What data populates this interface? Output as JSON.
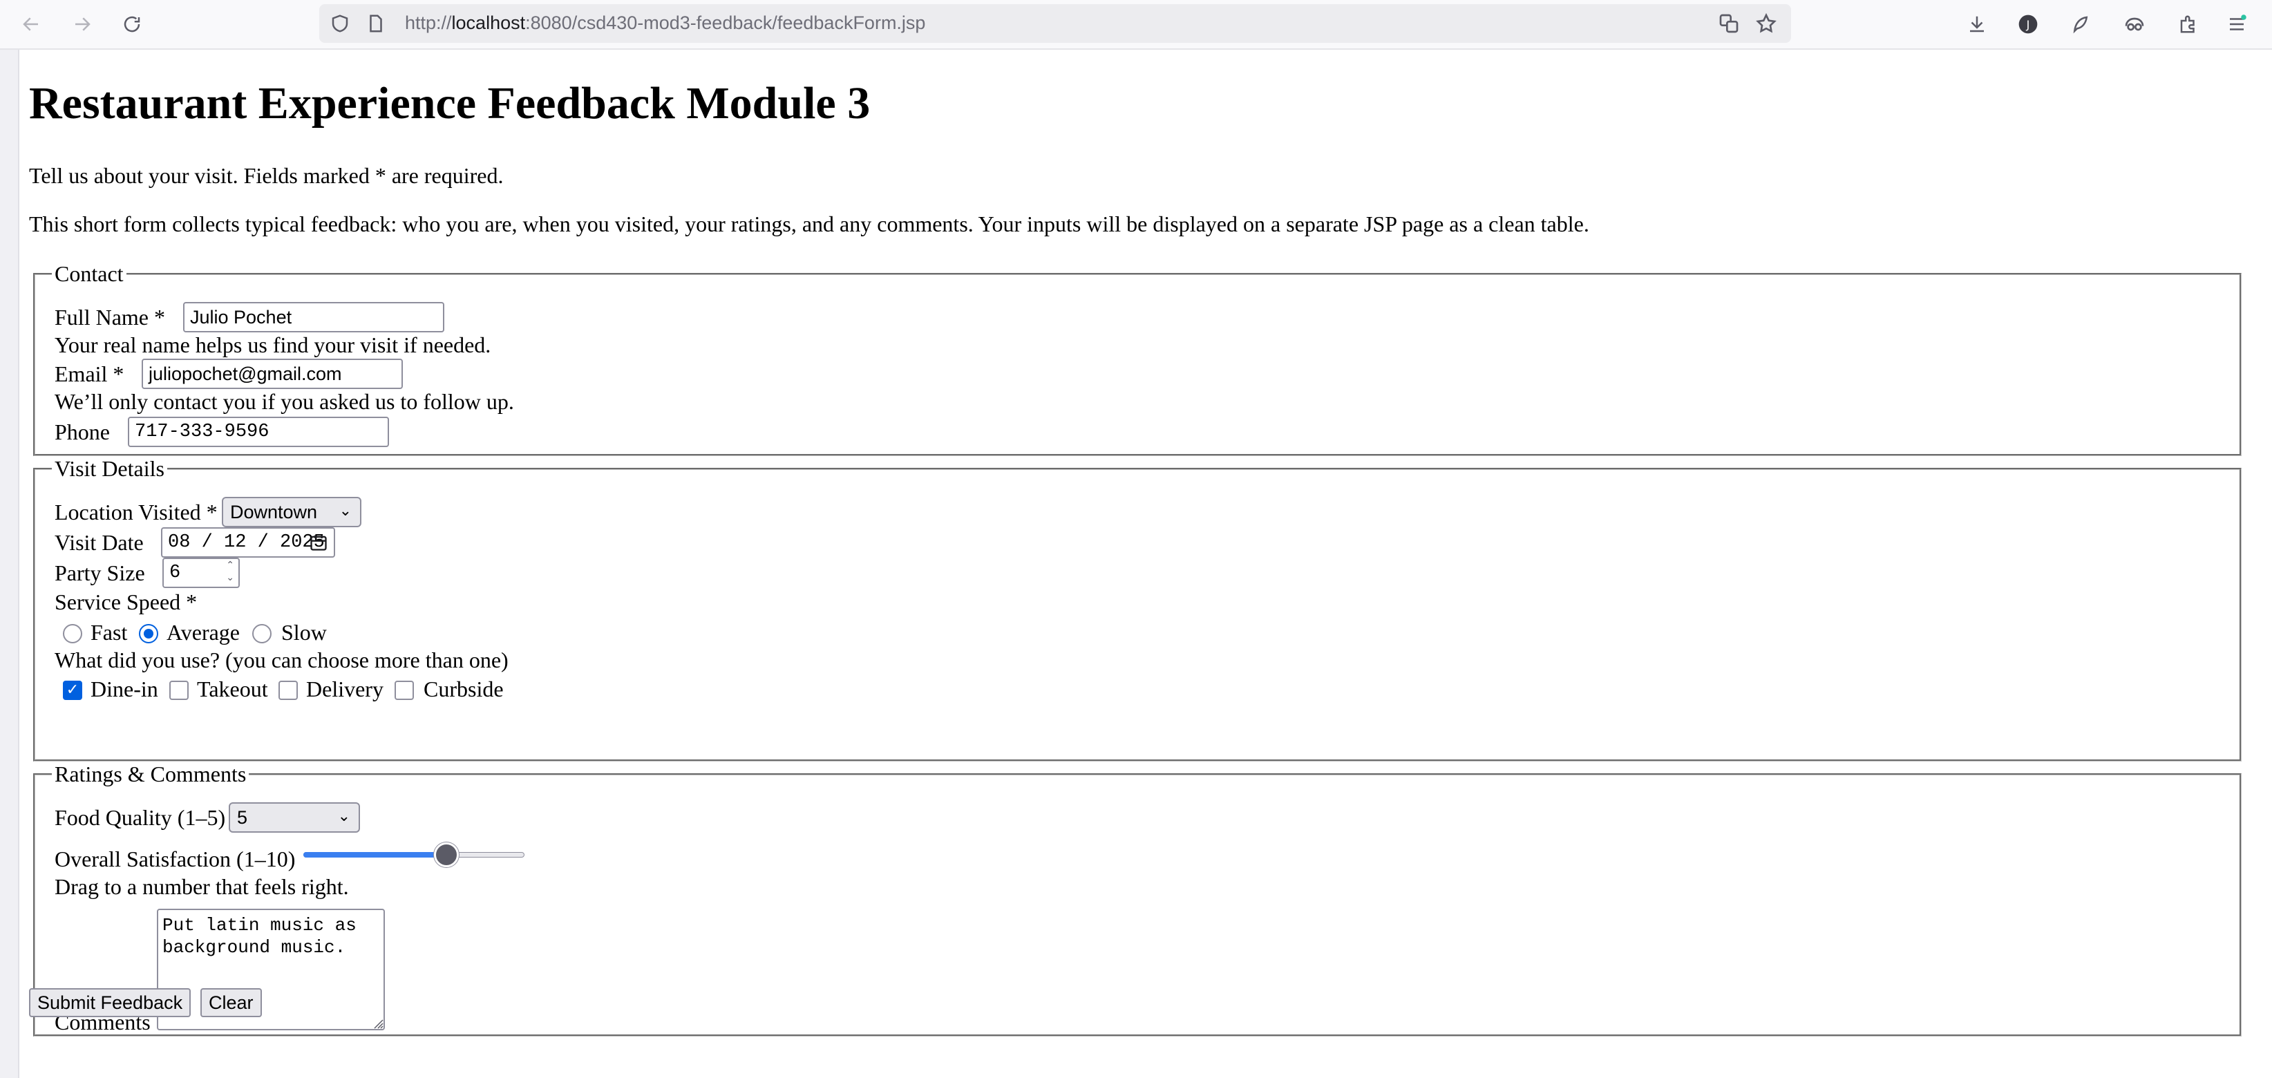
{
  "browser": {
    "url_prefix": "http://",
    "url_host": "localhost",
    "url_rest": ":8080/csd430-mod3-feedback/feedbackForm.jsp",
    "back_icon": "arrow-left-icon",
    "forward_icon": "arrow-right-icon",
    "reload_icon": "reload-icon"
  },
  "page": {
    "title": "Restaurant Experience Feedback Module 3",
    "intro1": "Tell us about your visit. Fields marked * are required.",
    "intro2": "This short form collects typical feedback: who you are, when you visited, your ratings, and any comments. Your inputs will be displayed on a separate JSP page as a clean table."
  },
  "contact": {
    "legend": "Contact",
    "name_label": "Full Name *",
    "name_value": "Julio Pochet",
    "name_help": "Your real name helps us find your visit if needed.",
    "email_label": "Email *",
    "email_value": "juliopochet@gmail.com",
    "email_help": "We’ll only contact you if you asked us to follow up.",
    "phone_label": "Phone",
    "phone_value": "717-333-9596"
  },
  "visit": {
    "legend": "Visit Details",
    "location_label": "Location Visited *",
    "location_value": "Downtown",
    "date_label": "Visit Date",
    "date_value": "08 / 12 / 2025",
    "party_label": "Party Size",
    "party_value": "6",
    "speed_label": "Service Speed *",
    "speed_options": [
      {
        "label": "Fast",
        "checked": false
      },
      {
        "label": "Average",
        "checked": true
      },
      {
        "label": "Slow",
        "checked": false
      }
    ],
    "use_label": "What did you use? (you can choose more than one)",
    "use_options": [
      {
        "label": "Dine-in",
        "checked": true
      },
      {
        "label": "Takeout",
        "checked": false
      },
      {
        "label": "Delivery",
        "checked": false
      },
      {
        "label": "Curbside",
        "checked": false
      }
    ]
  },
  "ratings": {
    "legend": "Ratings & Comments",
    "food_label": "Food Quality (1–5)",
    "food_value": "5",
    "satisfaction_label": "Overall Satisfaction (1–10)",
    "satisfaction_value": 7,
    "satisfaction_min": 1,
    "satisfaction_max": 10,
    "satisfaction_help": "Drag to a number that feels right.",
    "comments_label": "Comments",
    "comments_value": "Put latin music as\nbackground music."
  },
  "actions": {
    "submit_label": "Submit Feedback",
    "clear_label": "Clear"
  },
  "colors": {
    "accent": "#0060df",
    "slider_fill": "#3a7ff0",
    "slider_thumb": "#5b5b66"
  }
}
